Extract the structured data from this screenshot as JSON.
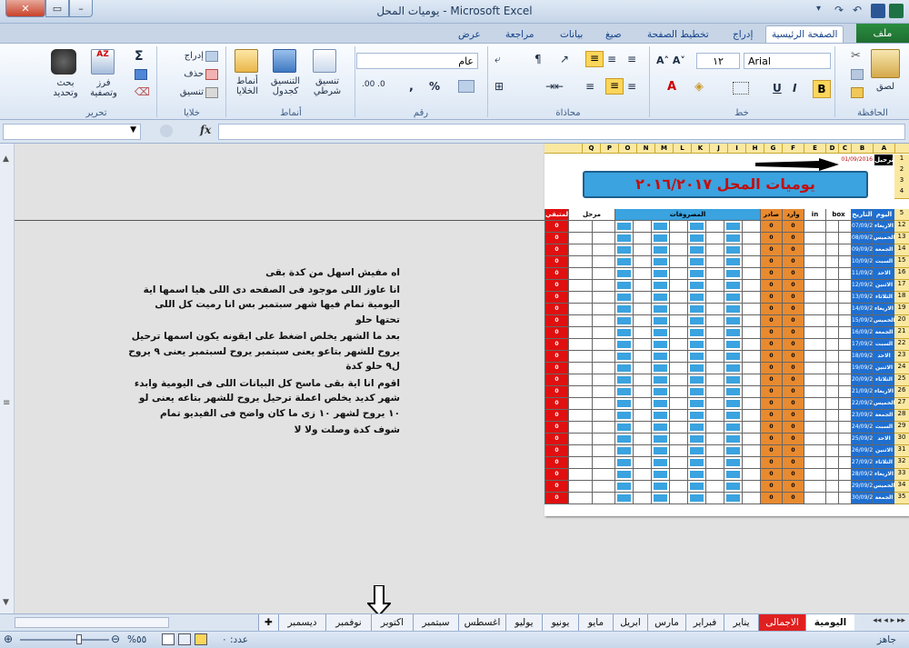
{
  "window": {
    "title": "يوميات المحل - Microsoft Excel",
    "close_glyph": "✕",
    "max_glyph": "▭",
    "min_glyph": "–"
  },
  "tabs": {
    "file": "ملف",
    "items": [
      "الصفحة الرئيسية",
      "إدراج",
      "تخطيط الصفحة",
      "صيغ",
      "بيانات",
      "مراجعة",
      "عرض"
    ]
  },
  "ribbon": {
    "clipboard": {
      "label": "الحافظة",
      "paste": "لصق"
    },
    "font": {
      "label": "خط",
      "name": "Arial",
      "size": "١٢",
      "bold": "B",
      "italic": "I",
      "underline": "U"
    },
    "alignment": {
      "label": "محاذاة"
    },
    "number": {
      "label": "رقم",
      "format": "عام",
      "percent": "%",
      "comma": ","
    },
    "styles": {
      "label": "أنماط",
      "conditional": "تنسيق شرطي",
      "table": "التنسيق كجدول",
      "cell": "أنماط الخلايا"
    },
    "cells": {
      "label": "خلايا",
      "insert": "إدراج",
      "delete": "حذف",
      "format": "تنسيق"
    },
    "editing": {
      "label": "تحرير",
      "sort": "فرز وتصفية",
      "find": "بحث وتحديد",
      "sum": "Σ"
    }
  },
  "formula_bar": {
    "fx": "fx"
  },
  "sheet": {
    "columns": [
      "A",
      "B",
      "C",
      "D",
      "E",
      "F",
      "G",
      "H",
      "I",
      "J",
      "K",
      "L",
      "M",
      "N",
      "O",
      "P",
      "Q"
    ],
    "transfer_label": "ترحيل",
    "transfer_date": "01/09/2016",
    "banner": "يوميات المحل ٢٠١٦/٢٠١٧",
    "headers": {
      "day": "اليوم",
      "date": "التاريخ",
      "box": "box",
      "in": "in",
      "ward": "وارد",
      "sadir": "صادر",
      "expenses": "المصروفات",
      "rahil": "مرحل",
      "motabaki": "المتبقي"
    },
    "rows": [
      {
        "n": "12",
        "day": "الاربعاء",
        "date": "07/09/2016"
      },
      {
        "n": "13",
        "day": "الخميس",
        "date": "08/09/2016"
      },
      {
        "n": "14",
        "day": "الجمعة",
        "date": "09/09/2016"
      },
      {
        "n": "15",
        "day": "السبت",
        "date": "10/09/2016"
      },
      {
        "n": "16",
        "day": "الاحد",
        "date": "11/09/2016"
      },
      {
        "n": "17",
        "day": "الاثنين",
        "date": "12/09/2016"
      },
      {
        "n": "18",
        "day": "الثلاثاء",
        "date": "13/09/2016"
      },
      {
        "n": "19",
        "day": "الاربعاء",
        "date": "14/09/2016"
      },
      {
        "n": "20",
        "day": "الخميس",
        "date": "15/09/2016"
      },
      {
        "n": "21",
        "day": "الجمعة",
        "date": "16/09/2016"
      },
      {
        "n": "22",
        "day": "السبت",
        "date": "17/09/2016"
      },
      {
        "n": "23",
        "day": "الاحد",
        "date": "18/09/2016"
      },
      {
        "n": "24",
        "day": "الاثنين",
        "date": "19/09/2016"
      },
      {
        "n": "25",
        "day": "الثلاثاء",
        "date": "20/09/2016"
      },
      {
        "n": "26",
        "day": "الاربعاء",
        "date": "21/09/2016"
      },
      {
        "n": "27",
        "day": "الخميس",
        "date": "22/09/2016"
      },
      {
        "n": "28",
        "day": "الجمعة",
        "date": "23/09/2016"
      },
      {
        "n": "29",
        "day": "السبت",
        "date": "24/09/2016"
      },
      {
        "n": "30",
        "day": "الاحد",
        "date": "25/09/2016"
      },
      {
        "n": "31",
        "day": "الاثنين",
        "date": "26/09/2016"
      },
      {
        "n": "32",
        "day": "الثلاثاء",
        "date": "27/09/2016"
      },
      {
        "n": "33",
        "day": "الاربعاء",
        "date": "28/09/2016"
      },
      {
        "n": "34",
        "day": "الخميس",
        "date": "29/09/2016"
      },
      {
        "n": "35",
        "day": "الجمعة",
        "date": "30/09/2016"
      }
    ],
    "zero": "0"
  },
  "notes": [
    "اه مفيش اسهل من كدة بقى",
    "انا عاوز اللى موجود فى الصفحه دى اللى هيا اسمها اية اليومية تمام فيها شهر سبتمبر بس انا رميت كل اللى تحتها حلو",
    "بعد ما الشهر يخلص اضغط على ايقونه يكون اسمها ترحيل يروح للشهر بتاعو يعنى سبتمبر يروح لسبتمبر يعنى ٩ يروح ل٩ حلو كدة",
    "اقوم انا اية بقى ماسح كل البيانات اللى فى اليومية وابدء شهر كديد يخلص اعملة ترحيل يروح للشهر بتاعه يعنى لو ١٠ يروح لشهر ١٠ زى ما كان واضح فى الفيديو تمام",
    "شوف كدة وصلت ولا لا"
  ],
  "sheet_tabs": [
    "اليومية",
    "الاجمالى",
    "يناير",
    "فبراير",
    "مارس",
    "ابريل",
    "مايو",
    "يونيو",
    "يوليو",
    "اغسطس",
    "سبتمبر",
    "اكتوبر",
    "نوفمبر",
    "ديسمبر"
  ],
  "status": {
    "ready": "جاهز",
    "count_label": "عدد: ٠",
    "zoom": "%٥٥"
  },
  "colors": {
    "day_blue": "#1f6fd0",
    "orange": "#e88a2f",
    "light_blue": "#3aa3e0",
    "red": "#e01010"
  }
}
